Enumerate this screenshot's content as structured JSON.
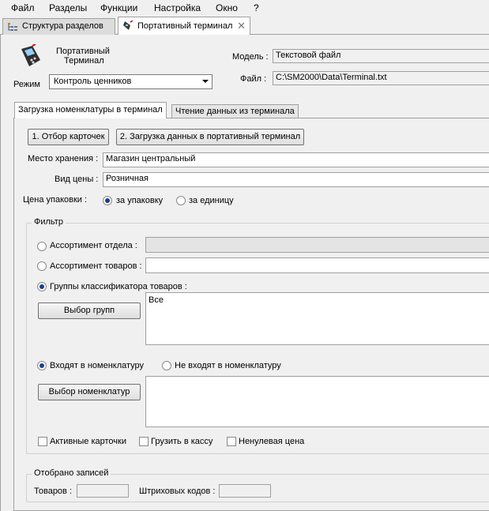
{
  "menu": [
    "Файл",
    "Разделы",
    "Функции",
    "Настройка",
    "Окно",
    "?"
  ],
  "doc_tabs": [
    {
      "label": "Структура разделов",
      "active": false
    },
    {
      "label": "Портативный терминал",
      "active": true,
      "close": "✕"
    }
  ],
  "header": {
    "title_line1": "Портативный",
    "title_line2": "Терминал",
    "mode_label": "Режим",
    "mode_value": "Контроль ценников",
    "model_label": "Модель :",
    "model_value": "Текстовой файл",
    "file_label": "Файл :",
    "file_value": "C:\\SM2000\\Data\\Terminal.txt"
  },
  "tabs": [
    "Загрузка номенклатуры в терминал",
    "Чтение данных из терминала"
  ],
  "actions": {
    "select_cards": "1. Отбор карточек",
    "load_data": "2. Загрузка данных в портативный терминал"
  },
  "storage": {
    "label": "Место хранения :",
    "value": "Магазин центральный"
  },
  "price_type": {
    "label": "Вид цены :",
    "value": "Розничная"
  },
  "pack_price": {
    "label": "Цена упаковки :",
    "option_pack": "за упаковку",
    "option_unit": "за единицу",
    "selected": "pack"
  },
  "filter": {
    "title": "Фильтр",
    "dept_assortment": "Ассортимент отдела :",
    "goods_assortment": "Ассортимент товаров :",
    "class_groups": "Группы классификатора товаров :",
    "select_groups_button": "Выбор групп",
    "groups_value": "Все",
    "include": "Входят в номенклатуру",
    "exclude": "Не входят в номенклатуру",
    "select_nomen_button": "Выбор номенклатур",
    "active_cards": "Активные карточки",
    "load_to_cash": "Грузить в кассу",
    "nonzero_price": "Ненулевая цена"
  },
  "records": {
    "title": "Отобрано записей",
    "goods_label": "Товаров :",
    "barcodes_label": "Штриховых кодов :"
  }
}
